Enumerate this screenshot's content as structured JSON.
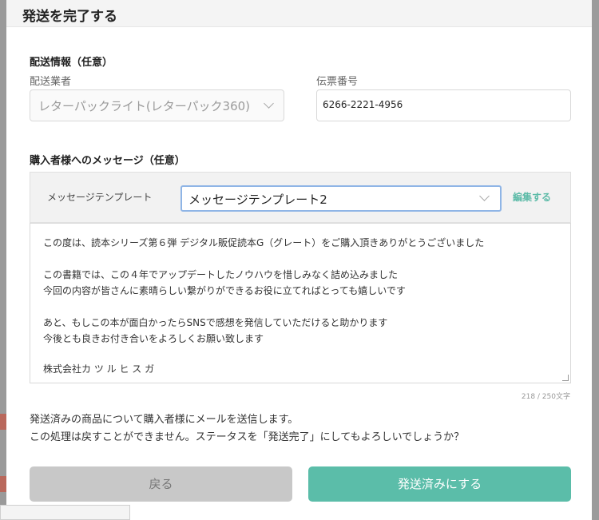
{
  "modal": {
    "title": "発送を完了する"
  },
  "shipping": {
    "section_title": "配送情報（任意）",
    "carrier_label": "配送業者",
    "carrier_value": "レターパックライト(レターパック360)",
    "tracking_label": "伝票番号",
    "tracking_value": "6266-2221-4956"
  },
  "message": {
    "section_title": "購入者様へのメッセージ（任意）",
    "template_label": "メッセージテンプレート",
    "template_selected": "メッセージテンプレート2",
    "edit_link": "編集する",
    "lines": [
      "この度は、読本シリーズ第６弾 デジタル販促読本G（グレート）をご購入頂きありがとうございました",
      "",
      "この書籍では、この４年でアップデートしたノウハウを惜しみなく詰め込みました",
      "今回の内容が皆さんに素晴らしい繋がりができるお役に立てればとっても嬉しいです",
      "",
      "あと、もしこの本が面白かったらSNSで感想を発信していただけると助かります",
      "今後とも良きお付き合いをよろしくお願い致します",
      "",
      "株式会社カ ツ ル ヒ ス ガ"
    ],
    "counter": "218 / 250文字"
  },
  "notice": {
    "line1": "発送済みの商品について購入者様にメールを送信します。",
    "line2": "この処理は戻すことができません。ステータスを「発送完了」にしてもよろしいでしょうか？"
  },
  "buttons": {
    "back": "戻る",
    "ship": "発送済みにする"
  },
  "colors": {
    "accent": "#5bbda9",
    "back_button": "#c8c8c8",
    "focus_border": "#8fb5e6"
  }
}
